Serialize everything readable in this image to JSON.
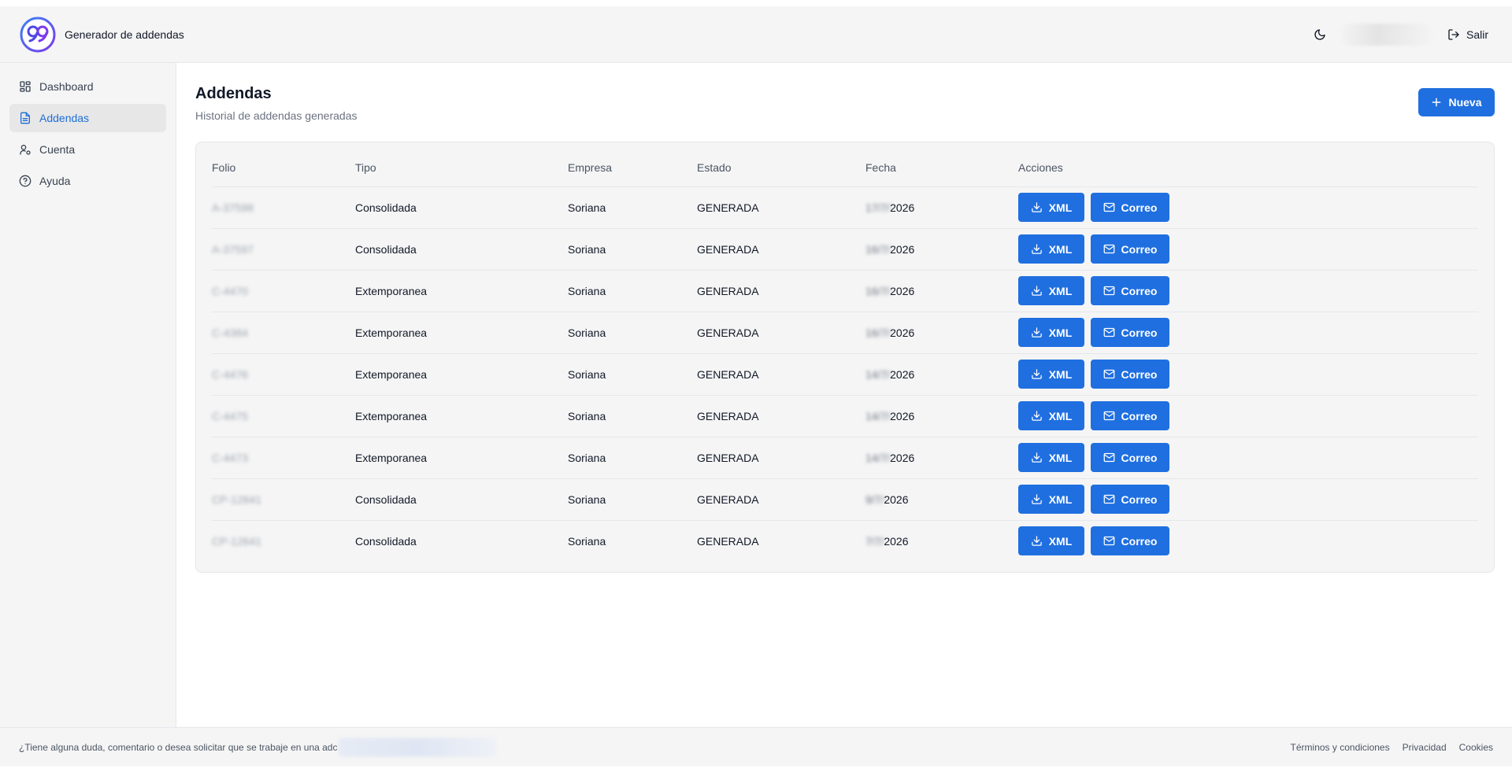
{
  "app": {
    "title": "Generador de addendas",
    "logo_icon": "infinity-99-logo",
    "brand_color": "#1f6fe0"
  },
  "header": {
    "logout_label": "Salir",
    "theme_icon": "moon-icon"
  },
  "sidebar": {
    "items": [
      {
        "label": "Dashboard",
        "icon": "dashboard-grid-icon",
        "active": false
      },
      {
        "label": "Addendas",
        "icon": "document-icon",
        "active": true
      },
      {
        "label": "Cuenta",
        "icon": "user-settings-icon",
        "active": false
      },
      {
        "label": "Ayuda",
        "icon": "help-circle-icon",
        "active": false
      }
    ]
  },
  "main": {
    "title": "Addendas",
    "subtitle": "Historial de addendas generadas",
    "new_button_label": "Nueva",
    "table": {
      "headers": [
        "Folio",
        "Tipo",
        "Empresa",
        "Estado",
        "Fecha",
        "Acciones"
      ],
      "action_labels": {
        "xml": "XML",
        "email": "Correo"
      },
      "rows": [
        {
          "folio": "A-37598",
          "tipo": "Consolidada",
          "empresa": "Soriana",
          "estado": "GENERADA",
          "fecha_prefix": "17/7/",
          "fecha_year": "2026"
        },
        {
          "folio": "A-37597",
          "tipo": "Consolidada",
          "empresa": "Soriana",
          "estado": "GENERADA",
          "fecha_prefix": "16/7/",
          "fecha_year": "2026"
        },
        {
          "folio": "C-4470",
          "tipo": "Extemporanea",
          "empresa": "Soriana",
          "estado": "GENERADA",
          "fecha_prefix": "16/7/",
          "fecha_year": "2026"
        },
        {
          "folio": "C-4384",
          "tipo": "Extemporanea",
          "empresa": "Soriana",
          "estado": "GENERADA",
          "fecha_prefix": "16/7/",
          "fecha_year": "2026"
        },
        {
          "folio": "C-4476",
          "tipo": "Extemporanea",
          "empresa": "Soriana",
          "estado": "GENERADA",
          "fecha_prefix": "14/7/",
          "fecha_year": "2026"
        },
        {
          "folio": "C-4475",
          "tipo": "Extemporanea",
          "empresa": "Soriana",
          "estado": "GENERADA",
          "fecha_prefix": "14/7/",
          "fecha_year": "2026"
        },
        {
          "folio": "C-4473",
          "tipo": "Extemporanea",
          "empresa": "Soriana",
          "estado": "GENERADA",
          "fecha_prefix": "14/7/",
          "fecha_year": "2026"
        },
        {
          "folio": "CP-12841",
          "tipo": "Consolidada",
          "empresa": "Soriana",
          "estado": "GENERADA",
          "fecha_prefix": "9/7/",
          "fecha_year": "2026"
        },
        {
          "folio": "CP-12641",
          "tipo": "Consolidada",
          "empresa": "Soriana",
          "estado": "GENERADA",
          "fecha_prefix": "7/7/",
          "fecha_year": "2026"
        }
      ]
    }
  },
  "footer": {
    "text": "¿Tiene alguna duda, comentario o desea solicitar que se trabaje en una adc",
    "links": [
      "Términos y condiciones",
      "Privacidad",
      "Cookies"
    ]
  }
}
